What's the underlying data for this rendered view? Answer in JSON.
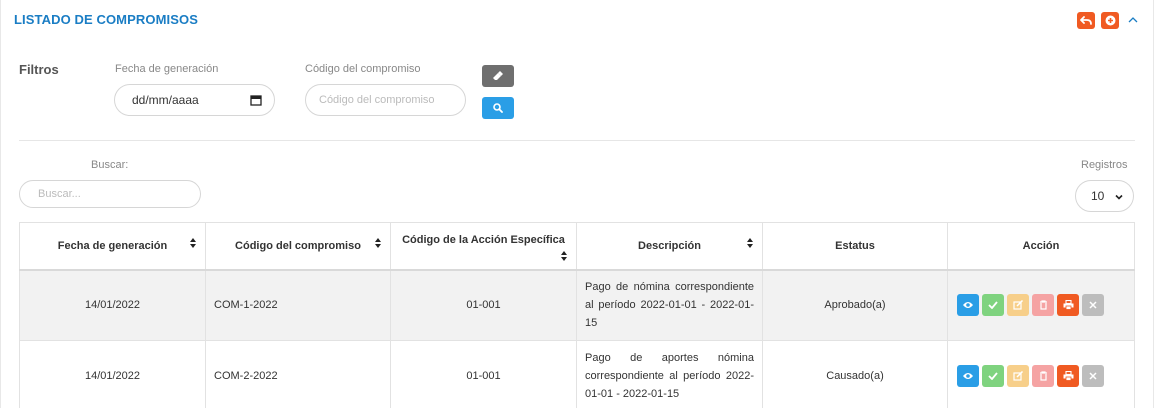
{
  "panel": {
    "title": "LISTADO DE COMPROMISOS",
    "header_icons": [
      "undo-icon",
      "add-circle-icon",
      "chevron-up-icon"
    ]
  },
  "filters": {
    "label": "Filtros",
    "date": {
      "label": "Fecha de generación",
      "value": "dd/mm/aaaa"
    },
    "code": {
      "label": "Código del compromiso",
      "placeholder": "Código del compromiso"
    },
    "buttons": {
      "clear_icon": "eraser-icon",
      "search_icon": "search-icon",
      "clear_color": "#6f6f6f",
      "search_color": "#2a9ee6"
    }
  },
  "table_controls": {
    "search_label": "Buscar:",
    "search_placeholder": "Buscar...",
    "records_label": "Registros",
    "records_value": "10"
  },
  "table": {
    "columns": [
      "Fecha de generación",
      "Código del compromiso",
      "Código de la Acción Específica",
      "Descripción",
      "Estatus",
      "Acción"
    ],
    "rows": [
      {
        "fecha": "14/01/2022",
        "codigo": "COM-1-2022",
        "accion_especifica": "01-001",
        "descripcion": "Pago de nómina correspondiente al período 2022-01-01 - 2022-01-15",
        "estatus": "Aprobado(a)",
        "estatus_color": "#2bb32b"
      },
      {
        "fecha": "14/01/2022",
        "codigo": "COM-2-2022",
        "accion_especifica": "01-001",
        "descripcion": "Pago de aportes nómina correspondiente al período 2022-01-01 - 2022-01-15",
        "estatus": "Causado(a)",
        "estatus_color": "#1a7dc4"
      }
    ],
    "action_buttons": [
      {
        "icon": "eye-icon",
        "color": "#2a9ee6"
      },
      {
        "icon": "check-icon",
        "color": "#7fd37f"
      },
      {
        "icon": "edit-icon",
        "color": "#f7cf8a"
      },
      {
        "icon": "trash-icon",
        "color": "#f5a3a3"
      },
      {
        "icon": "print-icon",
        "color": "#f05a22"
      },
      {
        "icon": "close-icon",
        "color": "#bdbdbd"
      }
    ]
  },
  "colors": {
    "accent": "#1a7dc4",
    "header_button": "#f05a22"
  }
}
